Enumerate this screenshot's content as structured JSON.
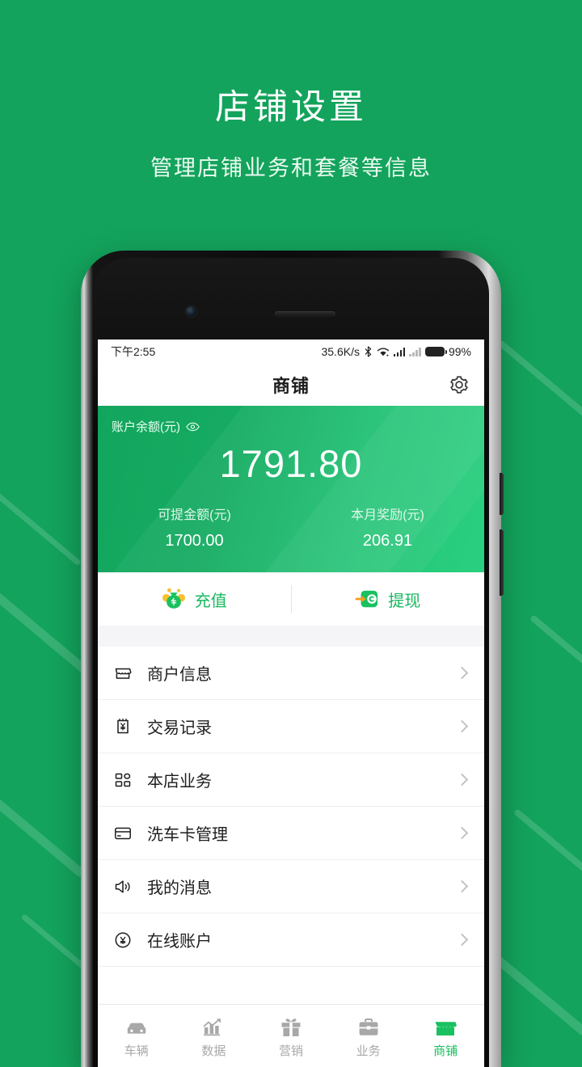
{
  "promo": {
    "title": "店铺设置",
    "subtitle": "管理店铺业务和套餐等信息"
  },
  "colors": {
    "brand_green": "#13a35c",
    "accent_green": "#19c160",
    "card_gradient_start": "#12a55d",
    "card_gradient_end": "#2ad07f",
    "coin_yellow": "#f9bf2e",
    "arrow_orange": "#f59b1c"
  },
  "status_bar": {
    "time": "下午2:55",
    "network_speed": "35.6K/s",
    "bluetooth_icon": "bluetooth-icon",
    "wifi_icon": "wifi-icon",
    "signal_icon": "signal-bars-icon",
    "signal_off_icon": "signal-bars-off-icon",
    "battery_icon": "battery-icon",
    "battery_level": "99%"
  },
  "title_bar": {
    "title": "商铺",
    "settings_icon": "gear-icon"
  },
  "balance": {
    "label": "账户余额(元)",
    "eye_icon": "eye-icon",
    "amount": "1791.80",
    "stats": [
      {
        "label": "可提金额(元)",
        "value": "1700.00"
      },
      {
        "label": "本月奖励(元)",
        "value": "206.91"
      }
    ]
  },
  "actions": [
    {
      "label": "充值",
      "icon": "money-bag-icon"
    },
    {
      "label": "提现",
      "icon": "wallet-withdraw-icon"
    }
  ],
  "menu": [
    {
      "label": "商户信息",
      "icon": "store-icon"
    },
    {
      "label": "交易记录",
      "icon": "receipt-yen-icon"
    },
    {
      "label": "本店业务",
      "icon": "grid-icon"
    },
    {
      "label": "洗车卡管理",
      "icon": "card-icon"
    },
    {
      "label": "我的消息",
      "icon": "speaker-icon"
    },
    {
      "label": "在线账户",
      "icon": "yen-circle-icon"
    }
  ],
  "tabbar": [
    {
      "label": "车辆",
      "icon": "car-icon",
      "active": false
    },
    {
      "label": "数据",
      "icon": "chart-icon",
      "active": false
    },
    {
      "label": "营销",
      "icon": "gift-icon",
      "active": false
    },
    {
      "label": "业务",
      "icon": "briefcase-icon",
      "active": false
    },
    {
      "label": "商铺",
      "icon": "store-filled-icon",
      "active": true
    }
  ]
}
